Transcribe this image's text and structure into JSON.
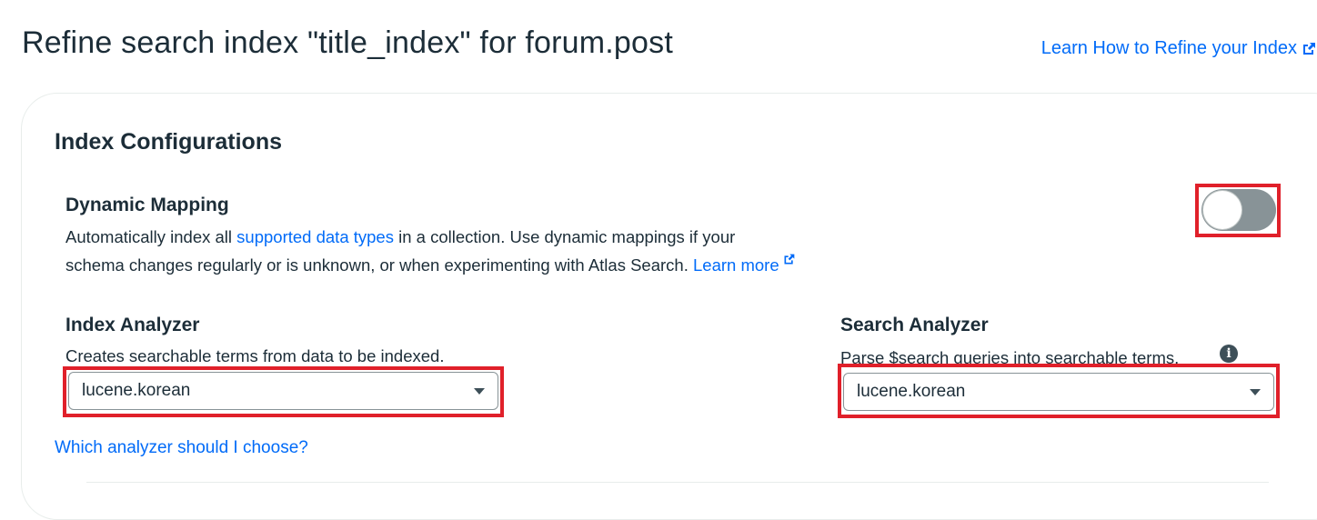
{
  "header": {
    "title": "Refine search index \"title_index\" for forum.post",
    "learn_link": "Learn How to Refine your Index",
    "learn_link_icon": "external-link-icon"
  },
  "config": {
    "section_title": "Index Configurations",
    "dynamic_mapping": {
      "title": "Dynamic Mapping",
      "desc_part1": "Automatically index all ",
      "desc_link": "supported data types",
      "desc_part2": " in a collection. Use dynamic mappings if your",
      "desc_line2": "schema changes regularly or is unknown, or when experimenting with Atlas Search. ",
      "learn_more": "Learn more",
      "toggle_on": false
    },
    "index_analyzer": {
      "title": "Index Analyzer",
      "desc": "Creates searchable terms from data to be indexed.",
      "value": "lucene.korean"
    },
    "search_analyzer": {
      "title": "Search Analyzer",
      "desc": "Parse $search queries into searchable terms.",
      "info_icon": "info-icon",
      "value": "lucene.korean"
    },
    "which_analyzer_link": "Which analyzer should I choose?"
  },
  "colors": {
    "link": "#016bf8",
    "highlight": "#e0202a",
    "toggle_off": "#889397",
    "text": "#1c2d38"
  }
}
